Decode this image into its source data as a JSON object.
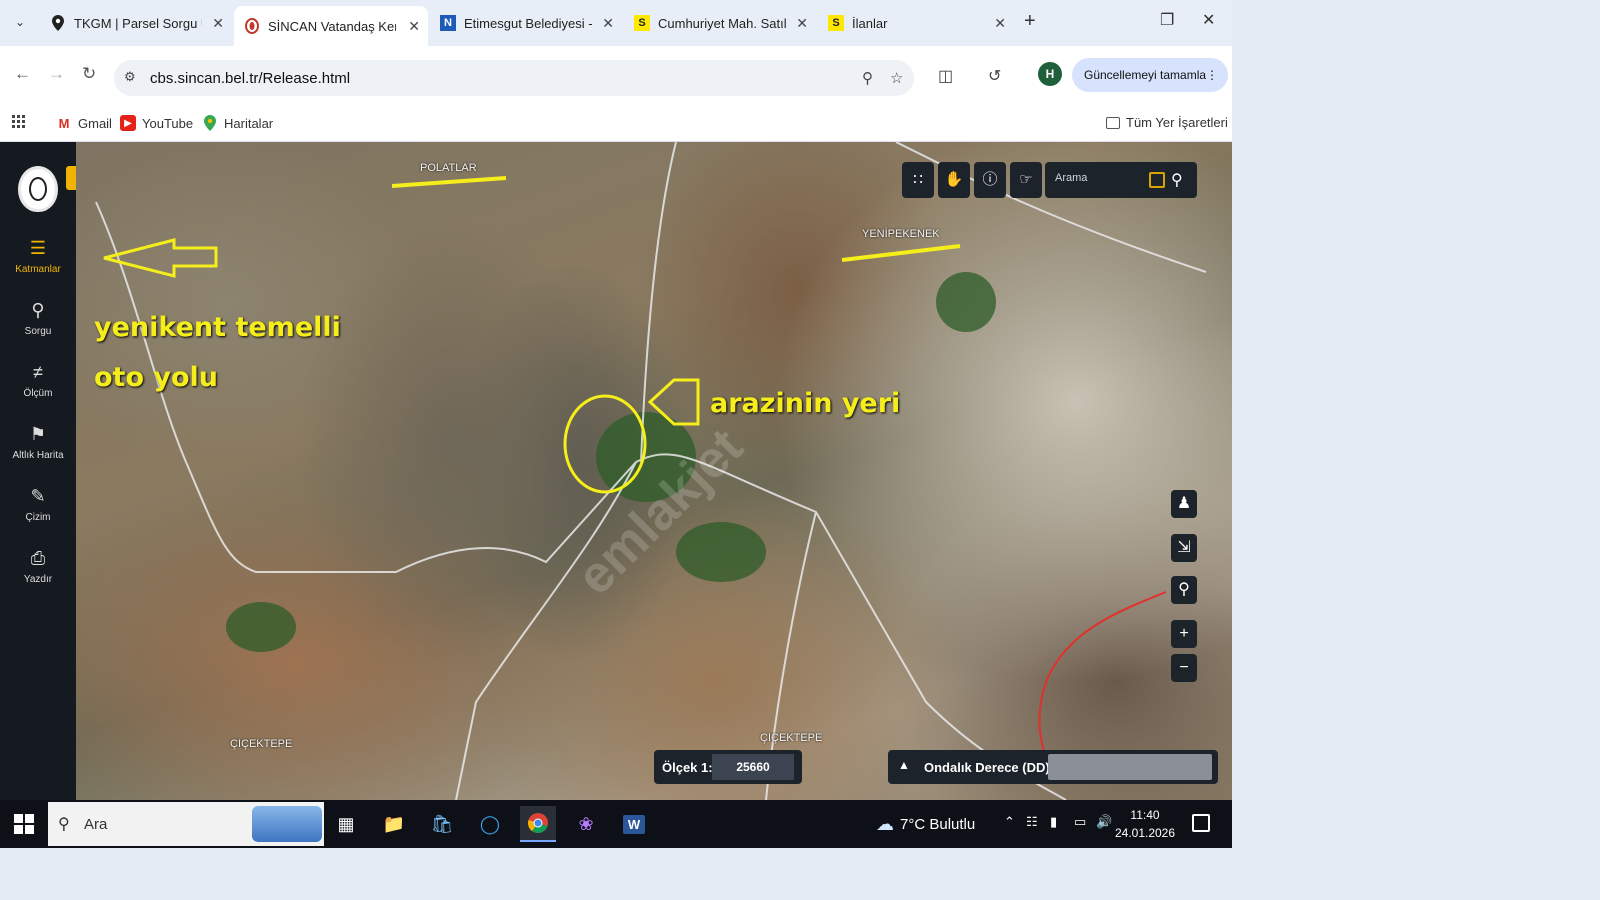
{
  "browser": {
    "tabs": [
      {
        "label": "TKGM | Parsel Sorgu Uyg",
        "icon": "map-pin-icon",
        "active": false
      },
      {
        "label": "SİNCAN Vatandaş Kent F",
        "icon": "sincan-logo-icon",
        "active": true
      },
      {
        "label": "Etimesgut Belediyesi - N",
        "icon": "etimesgut-logo-icon",
        "active": false
      },
      {
        "label": "Cumhuriyet Mah. Satılık",
        "icon": "sahibinden-s-icon",
        "active": false
      },
      {
        "label": "İlanlar",
        "icon": "sahibinden-s-icon",
        "active": false
      }
    ],
    "tab_icon_letters": {
      "sahibinden": "S",
      "etimesgut": "N"
    },
    "url": "cbs.sincan.bel.tr/Release.html",
    "profile_initial": "H",
    "update_button": "Güncellemeyi tamamla",
    "bookmarks": [
      {
        "label": "Gmail",
        "icon": "gmail-icon"
      },
      {
        "label": "YouTube",
        "icon": "youtube-icon"
      },
      {
        "label": "Haritalar",
        "icon": "maps-icon"
      }
    ],
    "all_bookmarks": "Tüm Yer İşaretleri"
  },
  "sidebar": {
    "items": [
      {
        "label": "Katmanlar",
        "icon": "layers-icon",
        "active": true
      },
      {
        "label": "Sorgu",
        "icon": "query-icon",
        "active": false
      },
      {
        "label": "Ölçüm",
        "icon": "measure-icon",
        "active": false
      },
      {
        "label": "Altlık Harita",
        "icon": "basemap-icon",
        "active": false
      },
      {
        "label": "Çizim",
        "icon": "draw-icon",
        "active": false
      },
      {
        "label": "Yazdır",
        "icon": "print-icon",
        "active": false
      }
    ],
    "accent": "#f0b400"
  },
  "map": {
    "search_placeholder": "Arama",
    "place_labels": [
      "POLATLAR",
      "YENİPEKENEK",
      "ÇIÇEKTEPE",
      "ÇIÇEKTEPE"
    ],
    "annotations": {
      "road_line1": "yenikent temelli",
      "road_line2": "oto yolu",
      "land_location": "arazinin yeri"
    },
    "annotation_color": "#f5ee1b",
    "scale_label": "Ölçek 1:",
    "scale_value": "25660",
    "coord_system": "Ondalık Derece (DD)",
    "watermark": "emlakjet"
  },
  "taskbar": {
    "search_placeholder": "Ara",
    "weather": "7°C Bulutlu",
    "time": "11:40",
    "date": "24.01.2026"
  }
}
